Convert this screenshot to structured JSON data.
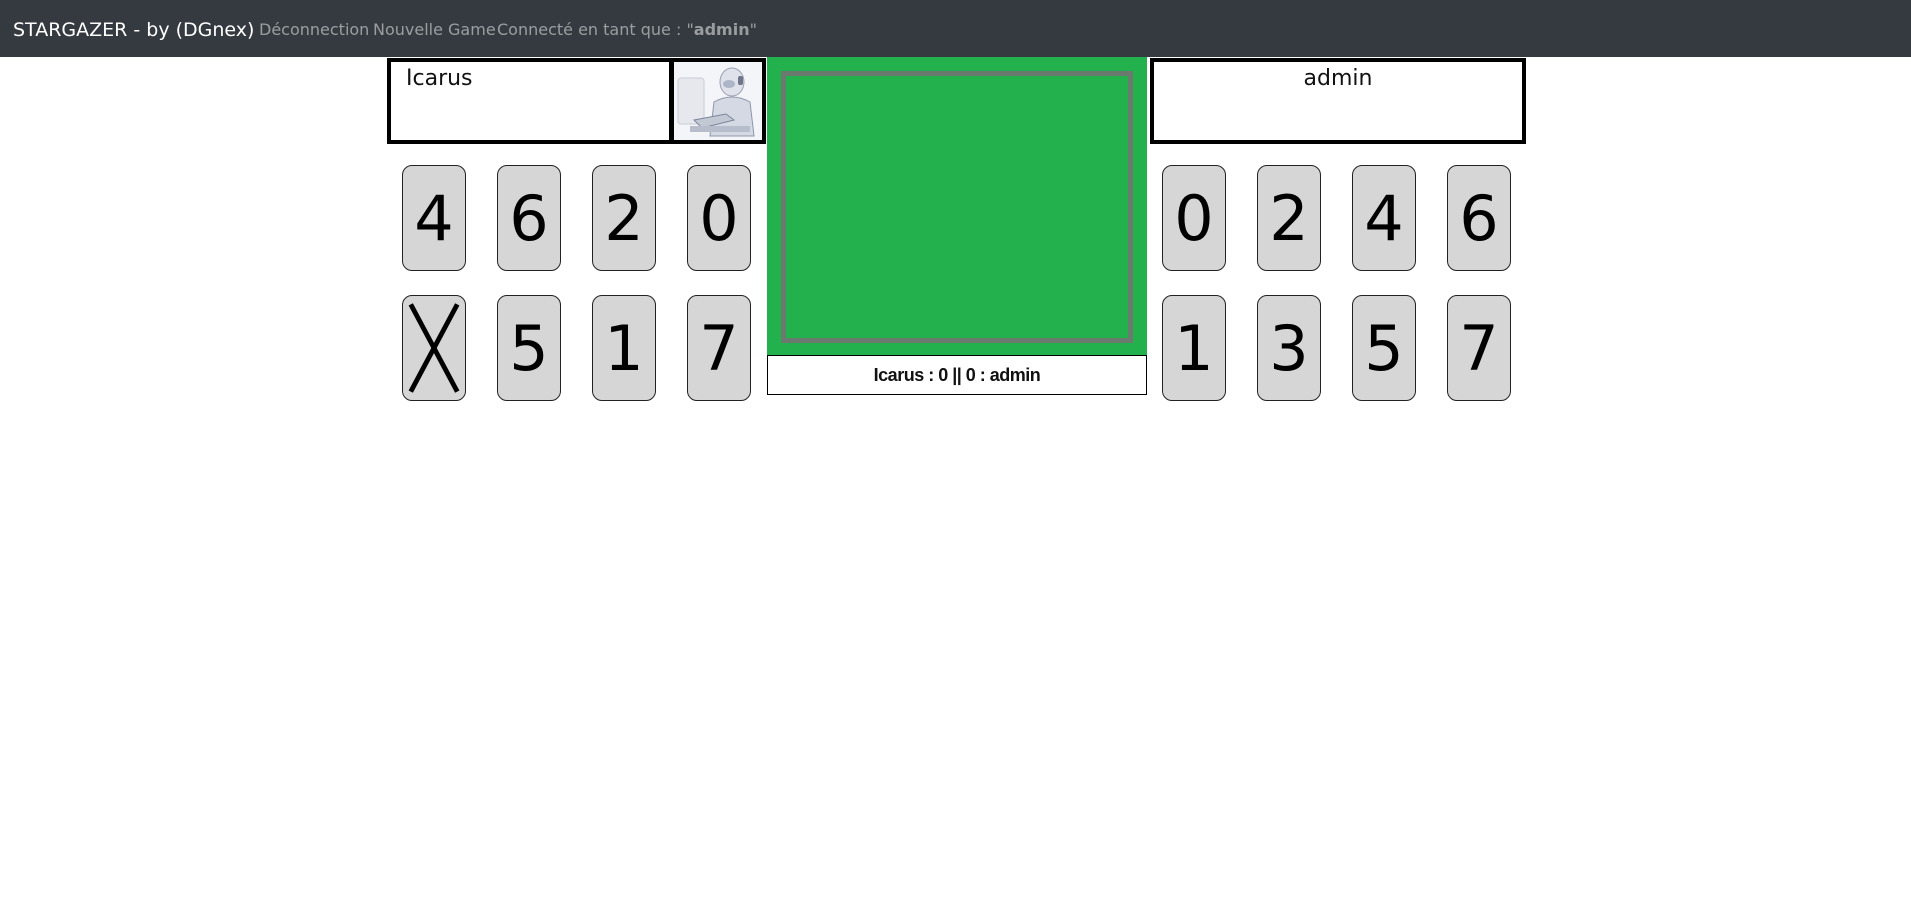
{
  "navbar": {
    "brand": "STARGAZER - by (DGnex)",
    "logout": "Déconnection",
    "new_game": "Nouvelle Game",
    "connected_prefix": "Connecté en tant que : \"",
    "connected_user": "admin",
    "connected_suffix": "\""
  },
  "opponent": {
    "name": "Icarus",
    "avatar_icon": "robot-avatar-icon",
    "cards_top": [
      "4",
      "6",
      "2",
      "0"
    ],
    "cards_bottom": [
      "X",
      "5",
      "1",
      "7"
    ]
  },
  "player": {
    "name": "admin",
    "cards_top": [
      "0",
      "2",
      "4",
      "6"
    ],
    "cards_bottom": [
      "1",
      "3",
      "5",
      "7"
    ]
  },
  "score": "Icarus : 0 || 0 : admin",
  "colors": {
    "navbar": "#343a40",
    "board": "#23b14d",
    "card": "#d6d6d6"
  }
}
